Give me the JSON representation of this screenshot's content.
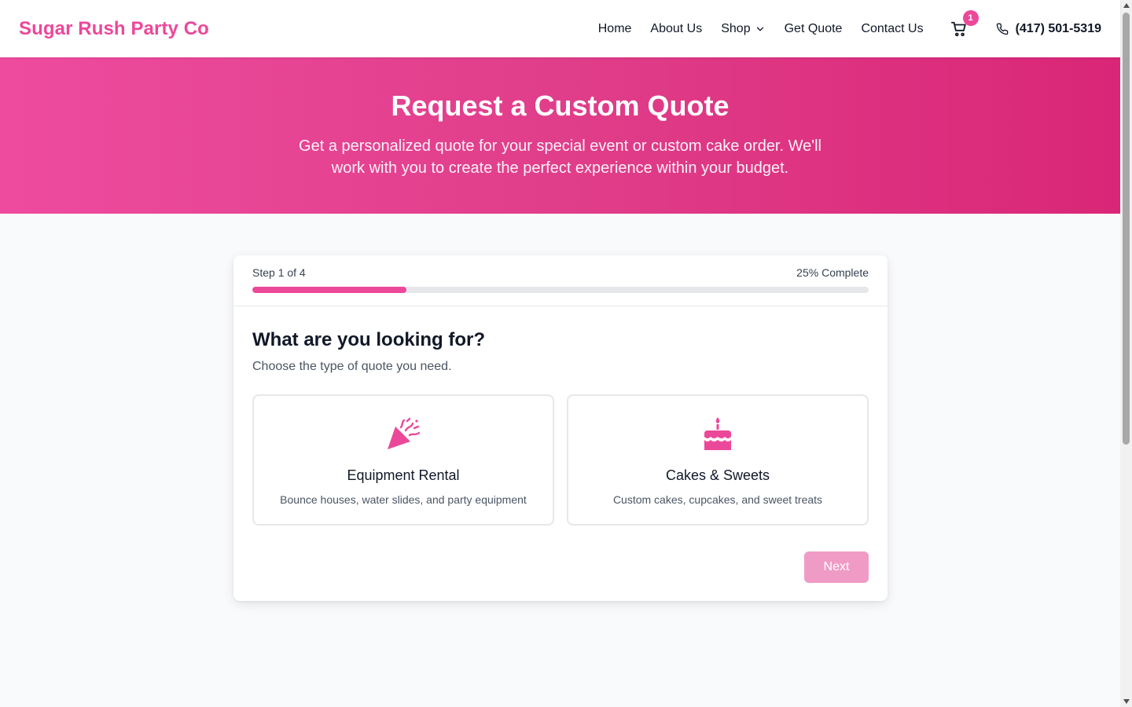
{
  "header": {
    "brand": "Sugar Rush Party Co",
    "nav": [
      {
        "label": "Home"
      },
      {
        "label": "About Us"
      },
      {
        "label": "Shop"
      },
      {
        "label": "Get Quote"
      },
      {
        "label": "Contact Us"
      }
    ],
    "cart_count": "1",
    "phone": "(417) 501-5319"
  },
  "hero": {
    "title": "Request a Custom Quote",
    "subtitle": "Get a personalized quote for your special event or custom cake order. We'll work with you to create the perfect experience within your budget."
  },
  "progress": {
    "step_label": "Step 1 of 4",
    "complete_label": "25% Complete",
    "fraction": 0.25
  },
  "form": {
    "heading": "What are you looking for?",
    "subheading": "Choose the type of quote you need.",
    "options": [
      {
        "icon": "party-popper-icon",
        "title": "Equipment Rental",
        "description": "Bounce houses, water slides, and party equipment"
      },
      {
        "icon": "birthday-cake-icon",
        "title": "Cakes & Sweets",
        "description": "Custom cakes, cupcakes, and sweet treats"
      }
    ],
    "next_label": "Next"
  },
  "colors": {
    "brand": "#ec4899",
    "hero_start": "#ee4b9f",
    "hero_end": "#da2677",
    "next_disabled": "#f09bc5"
  }
}
